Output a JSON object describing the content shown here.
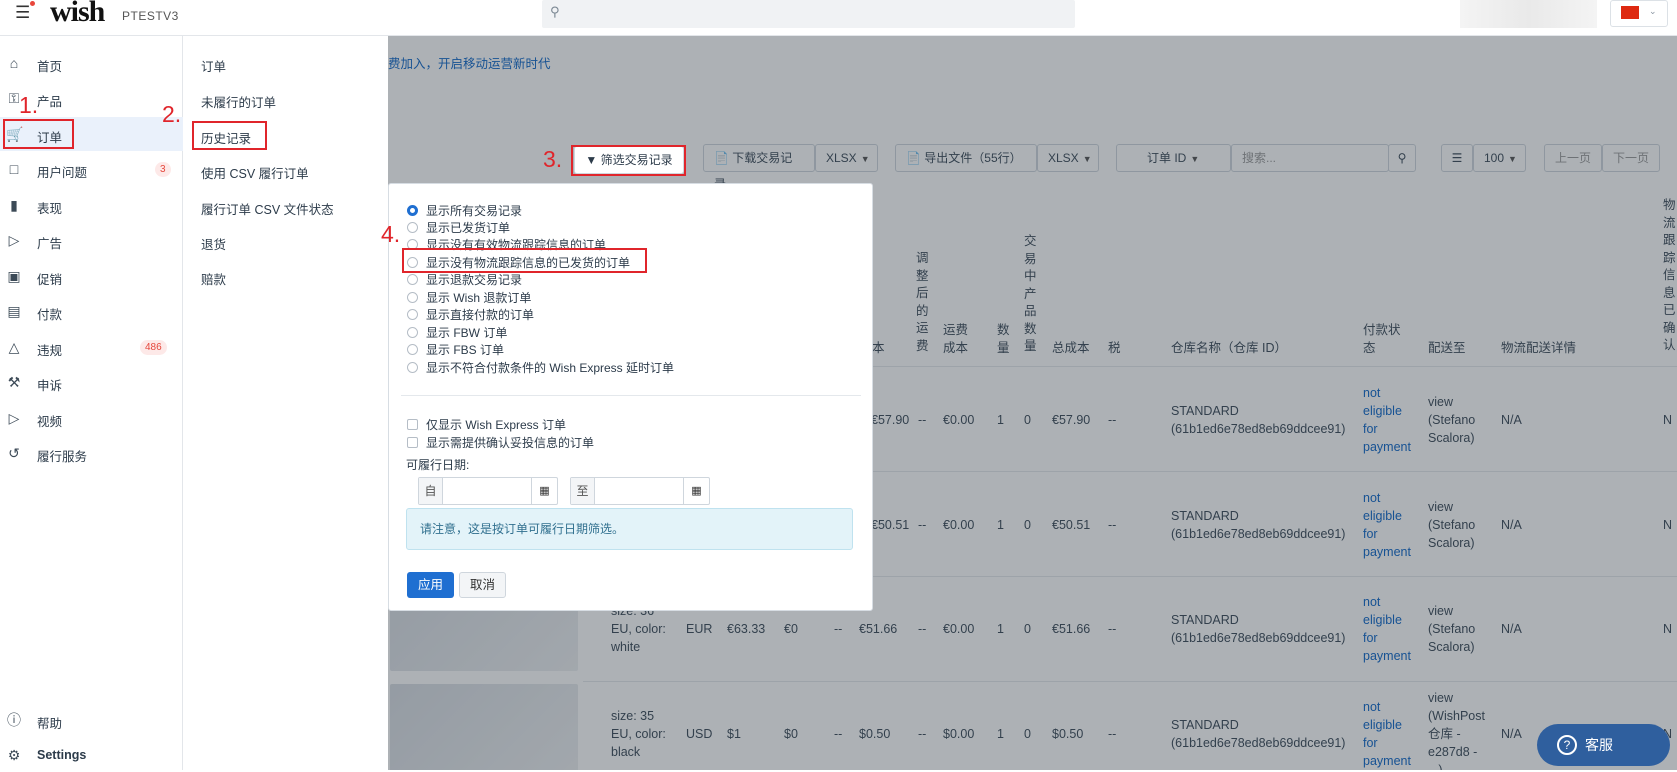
{
  "topbar": {
    "store_name": "PTESTV3",
    "logo": "wish",
    "search_placeholder": ""
  },
  "sidebar": {
    "items": [
      {
        "label": "首页",
        "icon": "home-icon"
      },
      {
        "label": "产品",
        "icon": "tag-icon"
      },
      {
        "label": "订单",
        "icon": "cart-icon",
        "active": true
      },
      {
        "label": "用户问题",
        "icon": "chat-icon",
        "badge": "3"
      },
      {
        "label": "表现",
        "icon": "bar-chart-icon"
      },
      {
        "label": "广告",
        "icon": "megaphone-icon"
      },
      {
        "label": "促销",
        "icon": "ticket-icon"
      },
      {
        "label": "付款",
        "icon": "card-icon"
      },
      {
        "label": "违规",
        "icon": "warning-icon",
        "badge": "486"
      },
      {
        "label": "申诉",
        "icon": "gavel-icon"
      },
      {
        "label": "视频",
        "icon": "video-icon"
      },
      {
        "label": "履行服务",
        "icon": "fulfillment-icon"
      }
    ],
    "bottom": [
      {
        "label": "帮助",
        "icon": "help-icon"
      },
      {
        "label": "Settings",
        "icon": "gear-icon"
      }
    ]
  },
  "submenu": {
    "items": [
      "订单",
      "未履行的订单",
      "历史记录",
      "使用 CSV 履行订单",
      "履行订单 CSV 文件状态",
      "退货",
      "赔款"
    ]
  },
  "main": {
    "banner": "费加入，开启移动运营新时代",
    "toolbar": {
      "filter_label": "筛选交易记录",
      "download_label": "下载交易记录",
      "download_format": "XLSX",
      "export_label": "导出文件（55行）",
      "export_format": "XLSX",
      "search_field": "订单 ID",
      "search_placeholder": "搜索...",
      "page_size": "100",
      "prev": "上一页",
      "next": "下一页"
    },
    "columns": {
      "c1": "本",
      "adjusted_shipping": "调\n整\n后\n的\n运\n费",
      "shipping_cost": "运费\n成本",
      "qty": "数\n量",
      "txn_qty": "交\n易\n中\n产\n品\n数\n量",
      "total_cost": "总成本",
      "tax": "税",
      "warehouse": "仓库名称（仓库 ID）",
      "payment_status": "付款状\n态",
      "ship_to": "配送至",
      "logistics": "物流配送详情",
      "tracking": "物\n流\n跟\n踪\n信\n息\n已\n确\n认"
    },
    "rows": [
      {
        "c1": "€57.90",
        "adj": "--",
        "ship": "€0.00",
        "qty": "1",
        "tq": "0",
        "total": "€57.90",
        "tax": "--",
        "warehouse": "STANDARD\n(61b1ed6e78ed8eb69ddcee91)",
        "pay": "not\neligible\nfor\npayment",
        "ship_to": "view\n(Stefano\nScalora)",
        "logistics": "N/A",
        "tracking": "N"
      },
      {
        "c1": "€50.51",
        "adj": "--",
        "ship": "€0.00",
        "qty": "1",
        "tq": "0",
        "total": "€50.51",
        "tax": "--",
        "warehouse": "STANDARD\n(61b1ed6e78ed8eb69ddcee91)",
        "pay": "not\neligible\nfor\npayment",
        "ship_to": "view\n(Stefano\nScalora)",
        "logistics": "N/A",
        "tracking": "N"
      },
      {
        "desc": "size: 36\nEU, color:\nwhite",
        "cur": "EUR",
        "price": "€63.33",
        "p2": "€0",
        "p3": "--",
        "c1": "€51.66",
        "adj": "--",
        "ship": "€0.00",
        "qty": "1",
        "tq": "0",
        "total": "€51.66",
        "tax": "--",
        "warehouse": "STANDARD\n(61b1ed6e78ed8eb69ddcee91)",
        "pay": "not\neligible\nfor\npayment",
        "ship_to": "view\n(Stefano\nScalora)",
        "logistics": "N/A",
        "tracking": "N"
      },
      {
        "desc": "size: 35\nEU, color:\nblack",
        "cur": "USD",
        "price": "$1",
        "p2": "$0",
        "p3": "--",
        "c1": "$0.50",
        "adj": "--",
        "ship": "$0.00",
        "qty": "1",
        "tq": "0",
        "total": "$0.50",
        "tax": "--",
        "warehouse": "STANDARD\n(61b1ed6e78ed8eb69ddcee91)",
        "pay": "not\neligible\nfor\npayment",
        "ship_to": "view\n(WishPost\n仓库 -\ne287d8 -\n...)",
        "logistics": "N/A",
        "tracking": "N"
      }
    ]
  },
  "filter_dropdown": {
    "radios": [
      {
        "label": "显示所有交易记录",
        "checked": true
      },
      {
        "label": "显示已发货订单",
        "checked": false
      },
      {
        "label": "显示没有有效物流跟踪信息的订单",
        "checked": false
      },
      {
        "label": "显示没有物流跟踪信息的已发货的订单",
        "checked": false
      },
      {
        "label": "显示退款交易记录",
        "checked": false
      },
      {
        "label": "显示 Wish 退款订单",
        "checked": false
      },
      {
        "label": "显示直接付款的订单",
        "checked": false
      },
      {
        "label": "显示 FBW 订单",
        "checked": false
      },
      {
        "label": "显示 FBS 订单",
        "checked": false
      },
      {
        "label": "显示不符合付款条件的 Wish Express 延时订单",
        "checked": false
      }
    ],
    "checkboxes": [
      {
        "label": "仅显示 Wish Express 订单"
      },
      {
        "label": "显示需提供确认妥投信息的订单"
      }
    ],
    "date_label": "可履行日期:",
    "from_label": "自",
    "to_label": "至",
    "note": "请注意，这是按订单可履行日期筛选。",
    "apply_label": "应用",
    "cancel_label": "取消"
  },
  "annotations": [
    "1.",
    "2.",
    "3.",
    "4."
  ],
  "help_button": {
    "label": "客服"
  },
  "colors": {
    "accent": "#1f6fd1",
    "link": "#0e67c9",
    "annotation_red": "#e0252b"
  }
}
